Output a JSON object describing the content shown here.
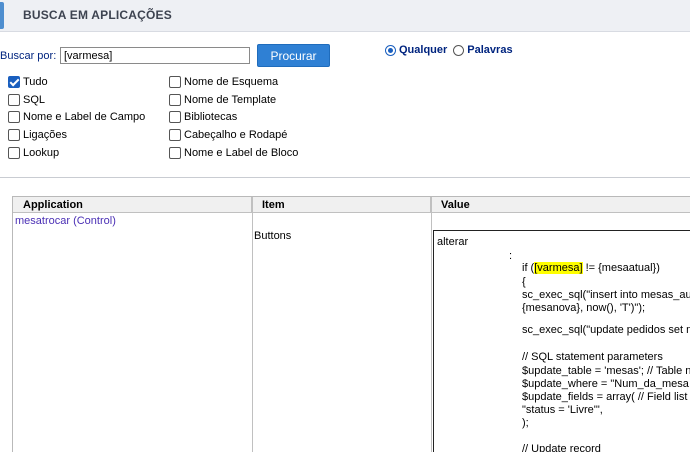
{
  "header": {
    "title": "BUSCA EM APLICAÇÕES"
  },
  "search": {
    "label": "Buscar por:",
    "value": "[varmesa]",
    "button_label": "Procurar"
  },
  "match_mode": {
    "options": [
      {
        "label": "Qualquer",
        "selected": true
      },
      {
        "label": "Palavras",
        "selected": false
      }
    ]
  },
  "filters": {
    "left": [
      {
        "label": "Tudo",
        "checked": true
      },
      {
        "label": "SQL",
        "checked": false
      },
      {
        "label": "Nome e Label de Campo",
        "checked": false
      },
      {
        "label": "Ligações",
        "checked": false
      },
      {
        "label": "Lookup",
        "checked": false
      }
    ],
    "right": [
      {
        "label": "Nome de Esquema",
        "checked": false
      },
      {
        "label": "Nome de Template",
        "checked": false
      },
      {
        "label": "Bibliotecas",
        "checked": false
      },
      {
        "label": "Cabeçalho e Rodapé",
        "checked": false
      },
      {
        "label": "Nome e Label de Bloco",
        "checked": false
      }
    ]
  },
  "results": {
    "columns": [
      "Application",
      "Item",
      "Value"
    ],
    "rows": [
      {
        "application": "mesatrocar (Control)",
        "item": "Buttons",
        "value": {
          "event_name": "alterar",
          "colon": ":",
          "if_prefix": "if (",
          "highlight": "[varmesa]",
          "if_suffix": " != {mesaatual})",
          "lines": [
            "{",
            "sc_exec_sql(\"insert into mesas_au",
            "{mesanova}, now(), 'T')\");",
            "",
            "sc_exec_sql(\"update pedidos set m",
            "",
            "// SQL statement parameters",
            "$update_table = 'mesas'; // Table n",
            "$update_where = \"Num_da_mesa",
            "$update_fields = array( // Field list",
            "\"status = 'Livre'\",",
            ");",
            "",
            "// Update record"
          ]
        }
      }
    ]
  },
  "colors": {
    "accent": "#2f80d4",
    "highlight": "#ffff00",
    "link": "#4a2fb5"
  }
}
